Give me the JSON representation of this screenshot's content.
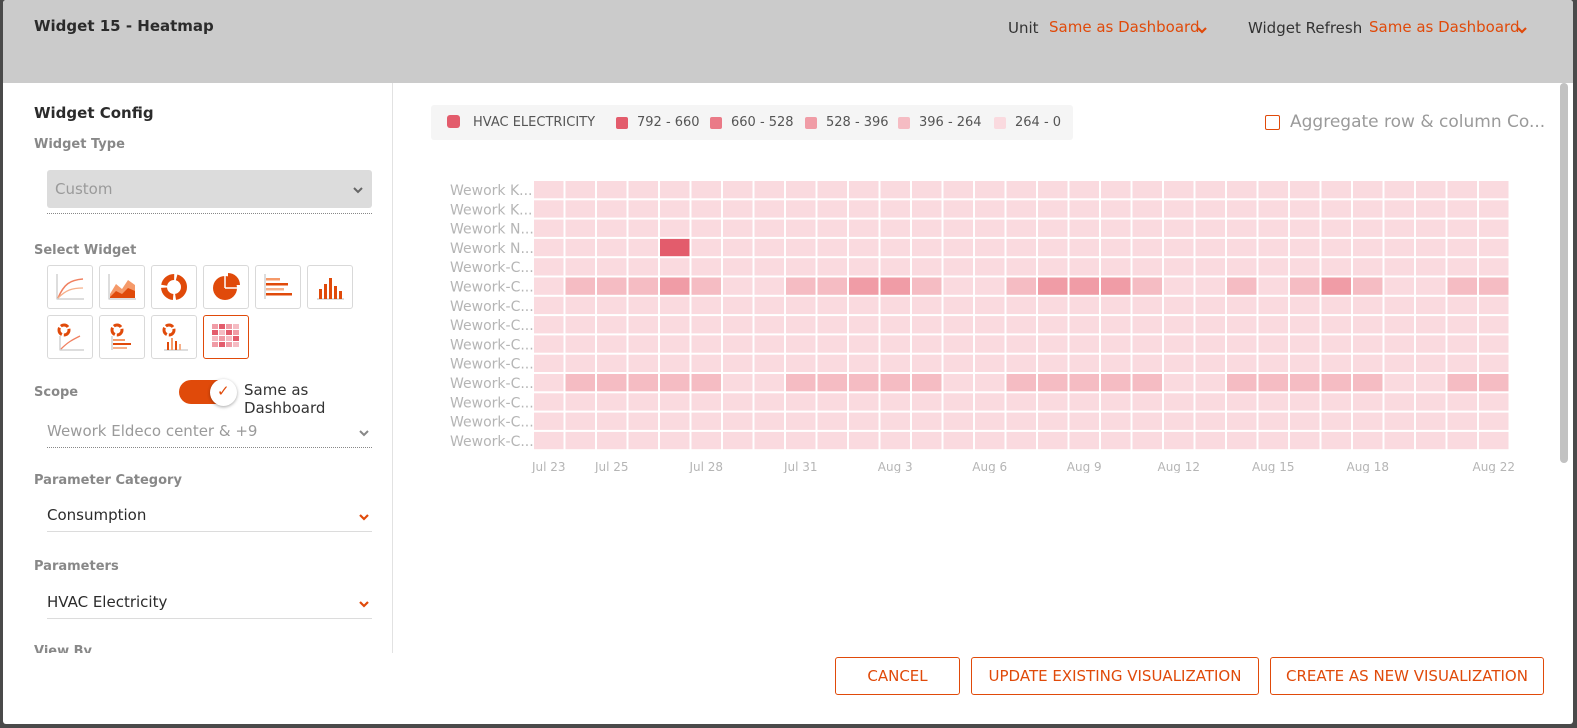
{
  "header": {
    "title": "Widget 15 - Heatmap",
    "unit_label": "Unit",
    "unit_value": "Same as Dashboard",
    "refresh_label": "Widget Refresh",
    "refresh_value": "Same as Dashboard"
  },
  "config": {
    "heading": "Widget Config",
    "widget_type_label": "Widget Type",
    "widget_type_value": "Custom",
    "select_widget_label": "Select Widget",
    "widget_icons": [
      "line-chart-icon",
      "area-chart-icon",
      "donut-chart-icon",
      "pie-chart-icon",
      "horizontal-bar-chart-icon",
      "vertical-bar-chart-icon",
      "donut-line-combo-icon",
      "donut-hbar-combo-icon",
      "donut-vbar-combo-icon",
      "heatmap-icon"
    ],
    "selected_widget": "heatmap-icon",
    "scope_label": "Scope",
    "scope_toggle_text": "Same as Dashboard",
    "scope_toggle_on": true,
    "scope_value": "Wework Eldeco center & +9",
    "param_category_label": "Parameter Category",
    "param_category_value": "Consumption",
    "parameters_label": "Parameters",
    "parameters_value": "HVAC Electricity",
    "view_by_label": "View By"
  },
  "legend": {
    "series": "HVAC ELECTRICITY",
    "ranges": [
      "792 - 660",
      "660 - 528",
      "528 - 396",
      "396 - 264",
      "264 - 0"
    ],
    "colors": [
      "#e35c6c",
      "#ea7a87",
      "#f09ca6",
      "#f5bcc3",
      "#fadadf"
    ]
  },
  "aggregate_label": "Aggregate row & column Co...",
  "aggregate_checked": false,
  "chart_data": {
    "type": "heatmap",
    "rows": [
      "Wework K...",
      "Wework K...",
      "Wework N...",
      "Wework N...",
      "Wework-C...",
      "Wework-C...",
      "Wework-C...",
      "Wework-C...",
      "Wework-C...",
      "Wework-C...",
      "Wework-C...",
      "Wework-C...",
      "Wework-C...",
      "Wework-C..."
    ],
    "x_ticks": [
      "Jul 23",
      "Jul 25",
      "Jul 28",
      "Jul 31",
      "Aug 3",
      "Aug 6",
      "Aug 9",
      "Aug 12",
      "Aug 15",
      "Aug 18",
      "Aug 22"
    ],
    "columns": 31,
    "levels": [
      [
        4,
        4,
        4,
        4,
        4,
        4,
        4,
        4,
        4,
        4,
        4,
        4,
        4,
        4,
        4,
        4,
        4,
        4,
        4,
        4,
        4,
        4,
        4,
        4,
        4,
        4,
        4,
        4,
        4,
        4,
        4
      ],
      [
        4,
        4,
        4,
        4,
        4,
        4,
        4,
        4,
        4,
        4,
        4,
        4,
        4,
        4,
        4,
        4,
        4,
        4,
        4,
        4,
        4,
        4,
        4,
        4,
        4,
        4,
        4,
        4,
        4,
        4,
        4
      ],
      [
        4,
        4,
        4,
        4,
        4,
        4,
        4,
        4,
        4,
        4,
        4,
        4,
        4,
        4,
        4,
        4,
        4,
        4,
        4,
        4,
        4,
        4,
        4,
        4,
        4,
        4,
        4,
        4,
        4,
        4,
        4
      ],
      [
        4,
        4,
        4,
        4,
        0,
        4,
        4,
        4,
        4,
        4,
        4,
        4,
        4,
        4,
        4,
        4,
        4,
        4,
        4,
        4,
        4,
        4,
        4,
        4,
        4,
        4,
        4,
        4,
        4,
        4,
        4
      ],
      [
        4,
        4,
        4,
        4,
        4,
        4,
        4,
        4,
        4,
        4,
        4,
        4,
        4,
        4,
        4,
        4,
        4,
        4,
        4,
        4,
        4,
        4,
        4,
        4,
        4,
        4,
        4,
        4,
        4,
        4,
        4
      ],
      [
        4,
        3,
        3,
        3,
        2,
        3,
        4,
        4,
        3,
        3,
        2,
        2,
        3,
        4,
        4,
        3,
        2,
        2,
        2,
        3,
        4,
        4,
        3,
        4,
        3,
        2,
        3,
        4,
        4,
        3,
        3
      ],
      [
        4,
        4,
        4,
        4,
        4,
        4,
        4,
        4,
        4,
        4,
        4,
        4,
        4,
        4,
        4,
        4,
        4,
        4,
        4,
        4,
        4,
        4,
        4,
        4,
        4,
        4,
        4,
        4,
        4,
        4,
        4
      ],
      [
        4,
        4,
        4,
        4,
        4,
        4,
        4,
        4,
        4,
        4,
        4,
        4,
        4,
        4,
        4,
        4,
        4,
        4,
        4,
        4,
        4,
        4,
        4,
        4,
        4,
        4,
        4,
        4,
        4,
        4,
        4
      ],
      [
        4,
        4,
        4,
        4,
        4,
        4,
        4,
        4,
        4,
        4,
        4,
        4,
        4,
        4,
        4,
        4,
        4,
        4,
        4,
        4,
        4,
        4,
        4,
        4,
        4,
        4,
        4,
        4,
        4,
        4,
        4
      ],
      [
        4,
        4,
        4,
        4,
        4,
        4,
        4,
        4,
        4,
        4,
        4,
        4,
        4,
        4,
        4,
        4,
        4,
        4,
        4,
        4,
        4,
        4,
        4,
        4,
        4,
        4,
        4,
        4,
        4,
        4,
        4
      ],
      [
        4,
        3,
        3,
        3,
        3,
        3,
        4,
        4,
        3,
        3,
        3,
        3,
        3,
        4,
        4,
        3,
        3,
        3,
        3,
        3,
        4,
        4,
        3,
        3,
        3,
        3,
        3,
        4,
        4,
        3,
        3
      ],
      [
        4,
        4,
        4,
        4,
        4,
        4,
        4,
        4,
        4,
        4,
        4,
        4,
        4,
        4,
        4,
        4,
        4,
        4,
        4,
        4,
        4,
        4,
        4,
        4,
        4,
        4,
        4,
        4,
        4,
        4,
        4
      ],
      [
        4,
        4,
        4,
        4,
        4,
        4,
        4,
        4,
        4,
        4,
        4,
        4,
        4,
        4,
        4,
        4,
        4,
        4,
        4,
        4,
        4,
        4,
        4,
        4,
        4,
        4,
        4,
        4,
        4,
        4,
        4
      ],
      [
        4,
        4,
        4,
        4,
        4,
        4,
        4,
        4,
        4,
        4,
        4,
        4,
        4,
        4,
        4,
        4,
        4,
        4,
        4,
        4,
        4,
        4,
        4,
        4,
        4,
        4,
        4,
        4,
        4,
        4,
        4
      ]
    ]
  },
  "footer": {
    "cancel": "CANCEL",
    "update": "UPDATE EXISTING VISUALIZATION",
    "create": "CREATE AS NEW VISUALIZATION"
  },
  "colors": {
    "accent": "#e04a0a",
    "header_bg": "#cbcbcb"
  }
}
